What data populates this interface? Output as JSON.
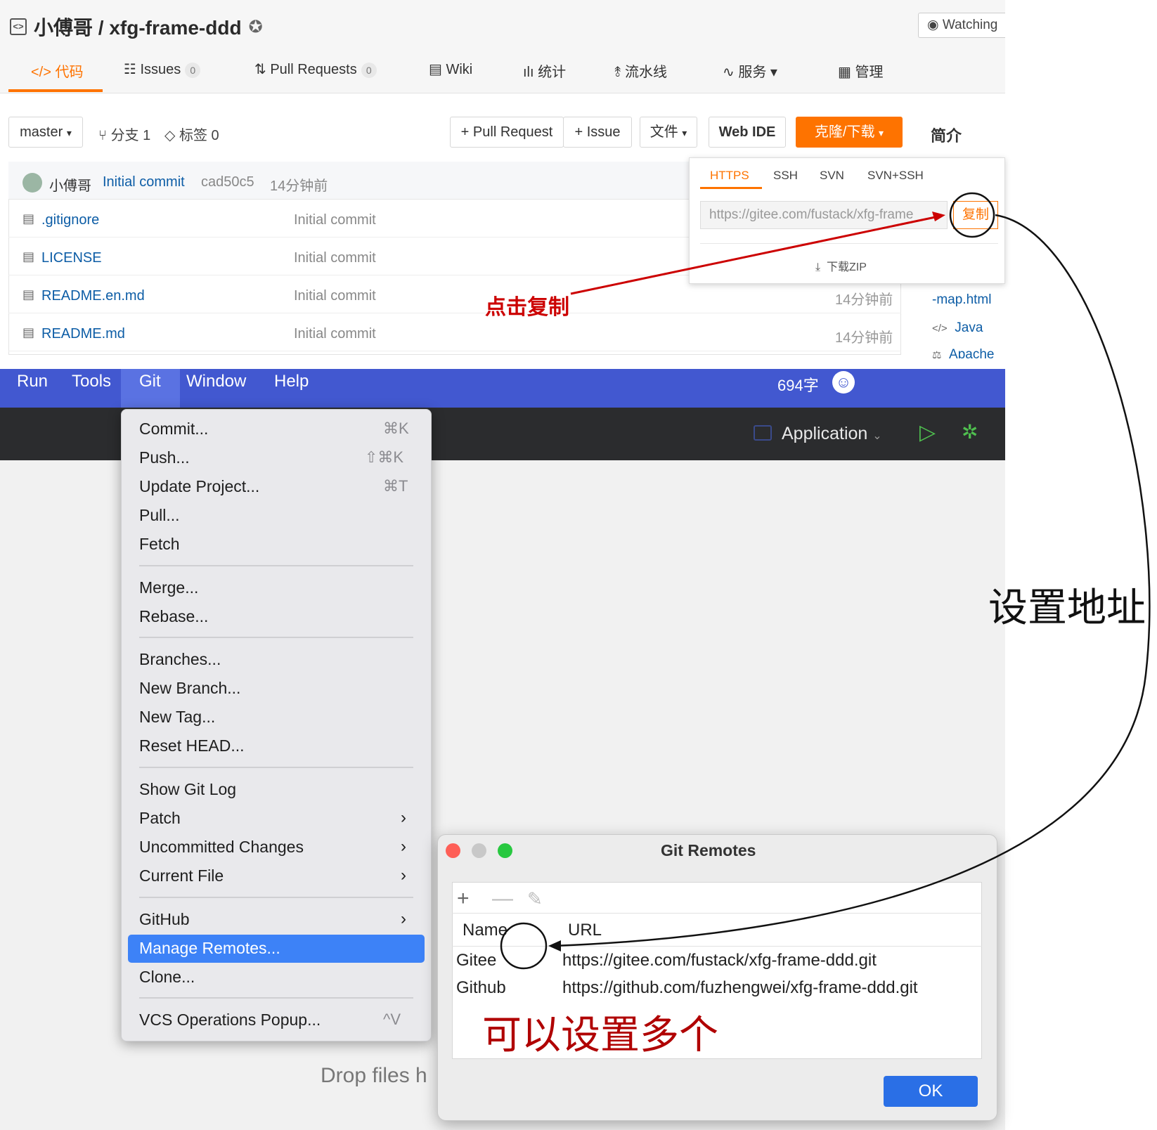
{
  "gitee": {
    "repo_title": "小傅哥 / xfg-frame-ddd",
    "watch_label": "Watching",
    "tabs": [
      {
        "label": "代码",
        "icon": "code-icon"
      },
      {
        "label": "Issues",
        "count": "0",
        "icon": "issues-icon"
      },
      {
        "label": "Pull Requests",
        "count": "0",
        "icon": "pull-request-icon"
      },
      {
        "label": "Wiki",
        "icon": "wiki-icon"
      },
      {
        "label": "统计",
        "icon": "stats-icon"
      },
      {
        "label": "流水线",
        "icon": "pipeline-icon"
      },
      {
        "label": "服务",
        "icon": "service-icon"
      },
      {
        "label": "管理",
        "icon": "manage-icon"
      }
    ],
    "branch_select": "master",
    "branches_label": "分支 1",
    "tags_label": "标签 0",
    "pull_request_btn": "+ Pull Request",
    "issue_btn": "+ Issue",
    "file_btn": "文件",
    "webide_btn": "Web IDE",
    "clone_btn": "克隆/下载",
    "intro_label": "简介",
    "last_commit": {
      "author": "小傅哥",
      "message": "Initial commit",
      "hash": "cad50c5",
      "time": "14分钟前"
    },
    "files": [
      {
        "name": ".gitignore",
        "message": "Initial commit",
        "time": ""
      },
      {
        "name": "LICENSE",
        "message": "Initial commit",
        "time": ""
      },
      {
        "name": "README.en.md",
        "message": "Initial commit",
        "time": "14分钟前"
      },
      {
        "name": "README.md",
        "message": "Initial commit",
        "time": "14分钟前"
      }
    ],
    "clone_popup": {
      "tabs": [
        "HTTPS",
        "SSH",
        "SVN",
        "SVN+SSH"
      ],
      "url": "https://gitee.com/fustack/xfg-frame",
      "copy_btn": "复制",
      "download_zip": "下载ZIP"
    },
    "sidebar": {
      "link1": "-map.html",
      "lang": "Java",
      "license": "Apache"
    }
  },
  "ide": {
    "menubar": [
      "Run",
      "Tools",
      "Git",
      "Window",
      "Help"
    ],
    "word_count": "694字",
    "run_config": "Application",
    "drop_hint": "Drop files h",
    "git_menu": {
      "items": [
        {
          "label": "Commit...",
          "shortcut": "⌘K"
        },
        {
          "label": "Push...",
          "shortcut": "⇧⌘K"
        },
        {
          "label": "Update Project...",
          "shortcut": "⌘T"
        },
        {
          "label": "Pull...",
          "shortcut": ""
        },
        {
          "label": "Fetch",
          "shortcut": ""
        },
        {
          "label": "Merge...",
          "shortcut": ""
        },
        {
          "label": "Rebase...",
          "shortcut": ""
        },
        {
          "label": "Branches...",
          "shortcut": ""
        },
        {
          "label": "New Branch...",
          "shortcut": ""
        },
        {
          "label": "New Tag...",
          "shortcut": ""
        },
        {
          "label": "Reset HEAD...",
          "shortcut": ""
        },
        {
          "label": "Show Git Log",
          "shortcut": ""
        },
        {
          "label": "Patch",
          "shortcut": ""
        },
        {
          "label": "Uncommitted Changes",
          "shortcut": ""
        },
        {
          "label": "Current File",
          "shortcut": ""
        },
        {
          "label": "GitHub",
          "shortcut": ""
        },
        {
          "label": "Manage Remotes...",
          "shortcut": ""
        },
        {
          "label": "Clone...",
          "shortcut": ""
        },
        {
          "label": "VCS Operations Popup...",
          "shortcut": "^V"
        }
      ]
    },
    "remotes_dialog": {
      "title": "Git Remotes",
      "col_name": "Name",
      "col_url": "URL",
      "rows": [
        {
          "name": "Gitee",
          "url": "https://gitee.com/fustack/xfg-frame-ddd.git"
        },
        {
          "name": "Github",
          "url": "https://github.com/fuzhengwei/xfg-frame-ddd.git"
        }
      ],
      "ok": "OK"
    }
  },
  "annotations": {
    "click_copy": "点击复制",
    "set_address": "设置地址",
    "multiple": "可以设置多个"
  },
  "colors": {
    "accent": "#fe7300",
    "ide_menubar": "#4258d0",
    "selection": "#3d82f7",
    "annotation": "#c00000"
  }
}
